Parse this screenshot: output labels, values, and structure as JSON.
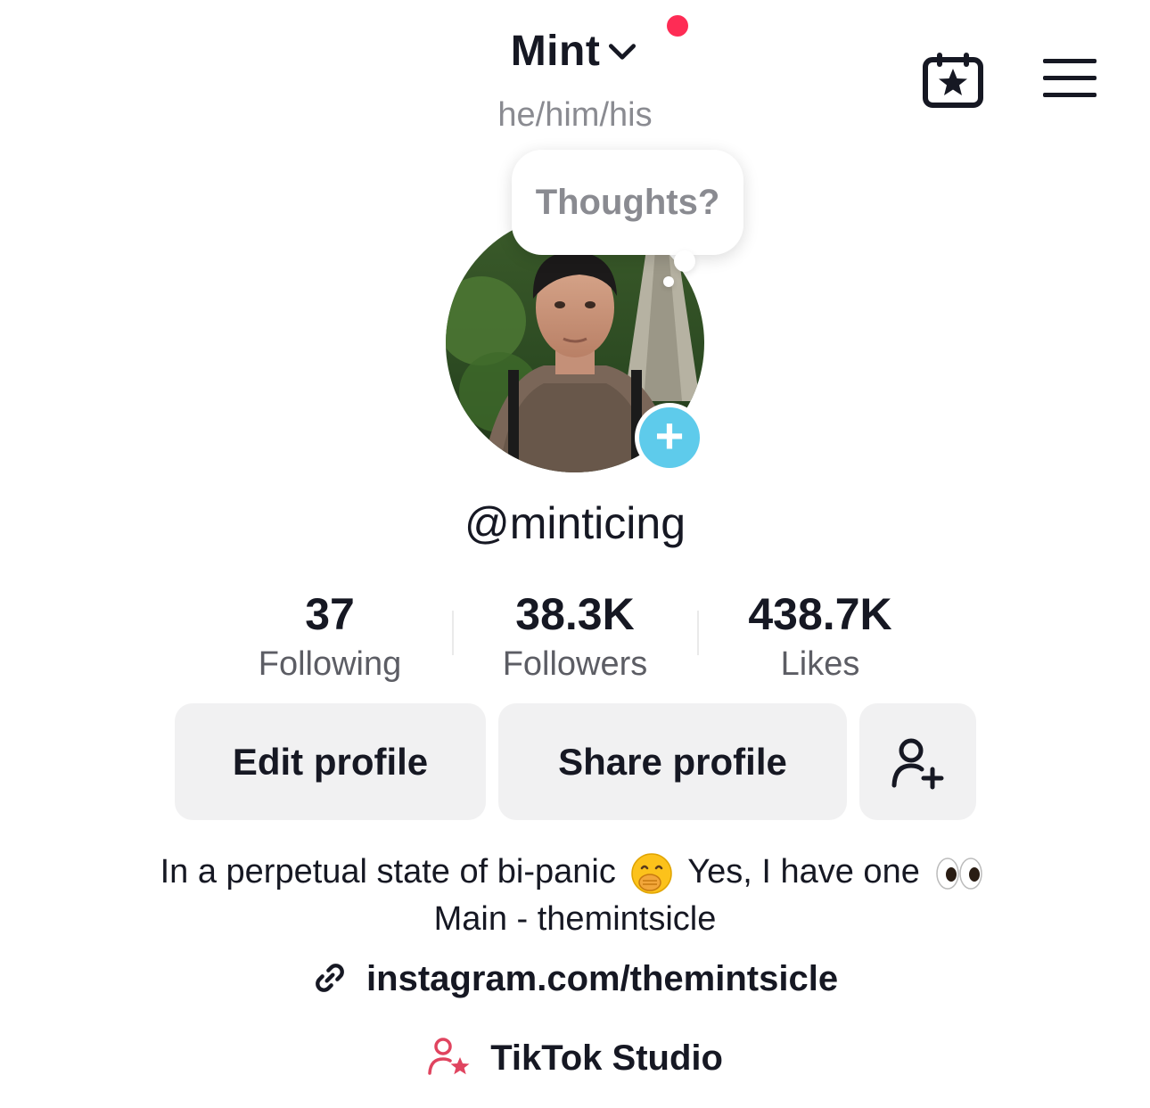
{
  "header": {
    "display_name": "Mint",
    "pronouns": "he/him/his",
    "notification_color": "#fe2c55",
    "calendar_icon": "calendar-star-icon",
    "menu_icon": "hamburger-menu-icon"
  },
  "note_bubble": {
    "text": "Thoughts?"
  },
  "profile": {
    "username": "@minticing",
    "add_story_icon": "plus-icon",
    "accent_color": "#5ecbeb"
  },
  "stats": {
    "following": {
      "value": "37",
      "label": "Following"
    },
    "followers": {
      "value": "38.3K",
      "label": "Followers"
    },
    "likes": {
      "value": "438.7K",
      "label": "Likes"
    }
  },
  "actions": {
    "edit_label": "Edit profile",
    "share_label": "Share profile",
    "add_friend_icon": "add-user-icon"
  },
  "bio": {
    "line1_part1": "In a perpetual state of bi-panic",
    "line1_part2": "Yes, I have one",
    "line2": "Main - themintsicle",
    "emoji1": "face-with-hand-over-mouth-emoji",
    "emoji2": "eyes-emoji"
  },
  "link": {
    "text": "instagram.com/themintsicle",
    "icon": "link-icon"
  },
  "studio": {
    "text": "TikTok Studio",
    "icon": "creator-star-icon",
    "icon_color": "#e0445f"
  }
}
